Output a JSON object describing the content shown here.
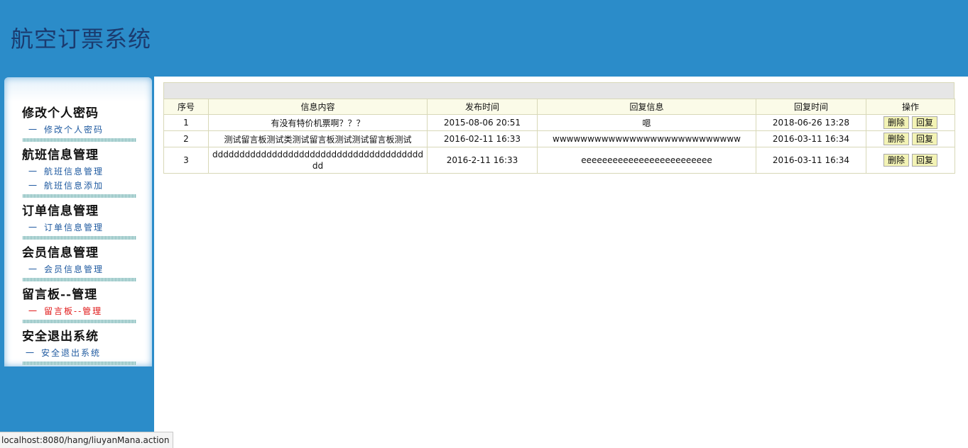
{
  "header": {
    "title": "航空订票系统"
  },
  "sidebar": {
    "sections": [
      {
        "heading": "修改个人密码",
        "items": [
          {
            "dash": "一",
            "label": "修改个人密码"
          }
        ]
      },
      {
        "heading": "航班信息管理",
        "items": [
          {
            "dash": "一",
            "label": "航班信息管理"
          },
          {
            "dash": "一",
            "label": "航班信息添加"
          }
        ]
      },
      {
        "heading": "订单信息管理",
        "items": [
          {
            "dash": "一",
            "label": "订单信息管理"
          }
        ]
      },
      {
        "heading": "会员信息管理",
        "items": [
          {
            "dash": "一",
            "label": "会员信息管理"
          }
        ]
      },
      {
        "heading": "留言板--管理",
        "items": [
          {
            "dash": "一",
            "label": "留言板--管理",
            "active": true
          }
        ]
      },
      {
        "heading": "安全退出系统",
        "items": [
          {
            "dash": "一",
            "label": "安全退出系统"
          }
        ]
      }
    ]
  },
  "table": {
    "columns": [
      "序号",
      "信息内容",
      "发布时间",
      "回复信息",
      "回复时间",
      "操作"
    ],
    "rows": [
      {
        "id": "1",
        "content": "有没有特价机票啊？？？",
        "publish_time": "2015-08-06 20:51",
        "reply": "嗯",
        "reply_time": "2018-06-26 13:28",
        "delete_label": "删除",
        "reply_label": "回复"
      },
      {
        "id": "2",
        "content": "测试留言板测试类测试留言板测试测试留言板测试",
        "publish_time": "2016-02-11 16:33",
        "reply": "wwwwwwwwwwwwwwwwwwwwwwwwwww",
        "reply_time": "2016-03-11 16:34",
        "delete_label": "删除",
        "reply_label": "回复"
      },
      {
        "id": "3",
        "content": "ddddddddddddddddddddddddddddddddddddddddd",
        "publish_time": "2016-2-11 16:33",
        "reply": "eeeeeeeeeeeeeeeeeeeeeeeee",
        "reply_time": "2016-03-11 16:34",
        "delete_label": "删除",
        "reply_label": "回复"
      }
    ]
  },
  "status": {
    "url": "localhost:8080/hang/liuyanMana.action"
  },
  "colors": {
    "header_bg": "#2b8cc9",
    "title": "#1b3b6f",
    "menu_link": "#1f5aa0",
    "menu_active": "#e01818",
    "table_header_bg": "#fbfbe8",
    "button_bg": "#f3f3b5"
  }
}
